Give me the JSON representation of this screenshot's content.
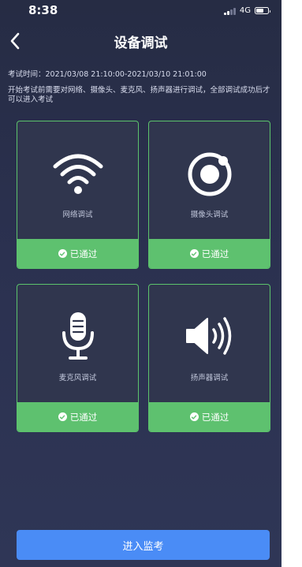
{
  "status_bar": {
    "time": "8:38",
    "network": "4G",
    "battery_level": 0.65
  },
  "header": {
    "back_icon": "chevron-left-icon",
    "title": "设备调试"
  },
  "exam_time": "考试时间：2021/03/08 21:10:00-2021/03/10 21:01:00",
  "instructions": "开始考试前需要对网络、摄像头、麦克风、扬声器进行调试，全部调试成功后才可以进入考试",
  "tiles": [
    {
      "label": "网络调试",
      "status": "已通过",
      "icon": "wifi-icon"
    },
    {
      "label": "摄像头调试",
      "status": "已通过",
      "icon": "camera-icon"
    },
    {
      "label": "麦克风调试",
      "status": "已通过",
      "icon": "microphone-icon"
    },
    {
      "label": "扬声器调试",
      "status": "已通过",
      "icon": "speaker-icon"
    }
  ],
  "enter_button": "进入监考",
  "colors": {
    "background": "#2b3150",
    "tile_background": "#30364e",
    "success_green": "#5ec16f",
    "primary_blue": "#4a8cf6"
  }
}
